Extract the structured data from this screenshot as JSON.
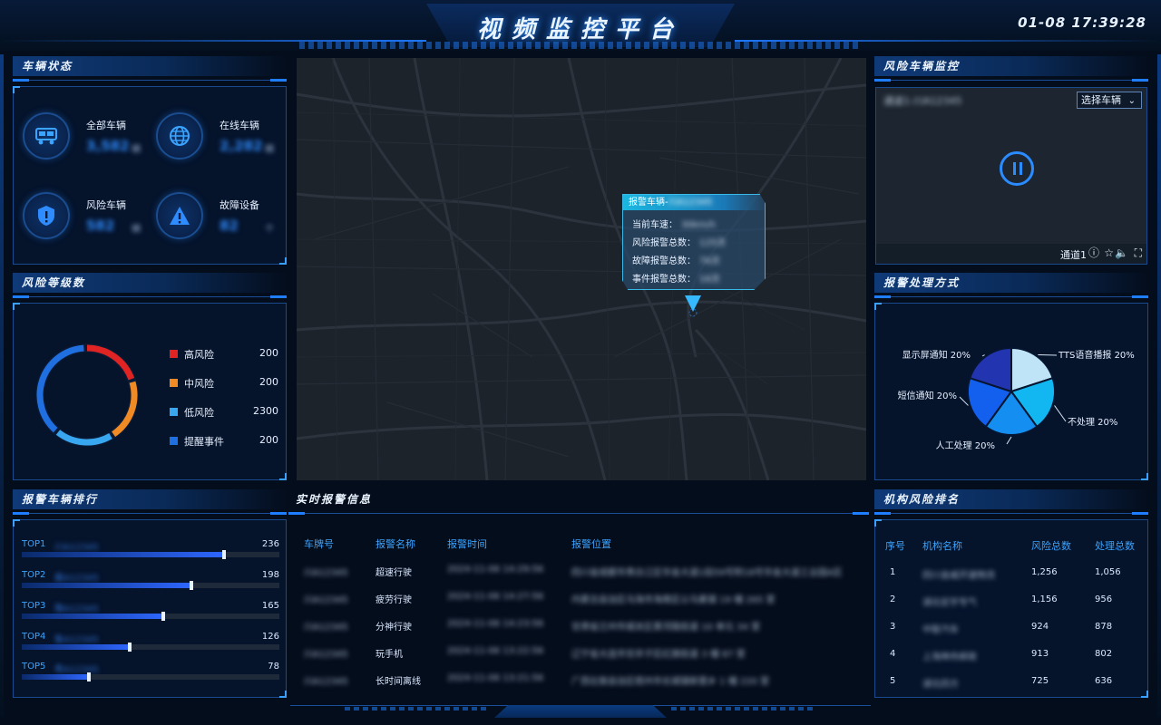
{
  "header": {
    "title": "视频监控平台",
    "clock": "01-08  17:39:28"
  },
  "vehicle_status": {
    "title": "车辆状态",
    "items": [
      {
        "label": "全部车辆",
        "value": "3,582",
        "unit": "辆",
        "icon": "truck-icon"
      },
      {
        "label": "在线车辆",
        "value": "2,282",
        "unit": "辆",
        "icon": "globe-icon"
      },
      {
        "label": "风险车辆",
        "value": "582",
        "unit": "辆",
        "icon": "shield-alert-icon"
      },
      {
        "label": "故障设备",
        "value": "82",
        "unit": "个",
        "icon": "warning-icon"
      }
    ]
  },
  "risk_levels": {
    "title": "风险等级数",
    "items": [
      {
        "name": "高风险",
        "value": "200",
        "color": "#e02424"
      },
      {
        "name": "中风险",
        "value": "200",
        "color": "#f08a24"
      },
      {
        "name": "低风险",
        "value": "2300",
        "color": "#39a6f0"
      },
      {
        "name": "提醒事件",
        "value": "200",
        "color": "#1f6fe0"
      }
    ]
  },
  "ranking": {
    "title": "报警车辆排行",
    "items": [
      {
        "rank": "TOP1",
        "plate": "川A12345",
        "value": 236
      },
      {
        "rank": "TOP2",
        "plate": "冀A12345",
        "value": 198
      },
      {
        "rank": "TOP3",
        "plate": "豫A12345",
        "value": 165
      },
      {
        "rank": "TOP4",
        "plate": "鲁A12345",
        "value": 126
      },
      {
        "rank": "TOP5",
        "plate": "粤A12345",
        "value": 78
      }
    ],
    "max": 300
  },
  "map_popup": {
    "head": "报警车辆-",
    "plate": "川A12345",
    "rows": [
      {
        "label": "当前车速：",
        "value": "30km/h"
      },
      {
        "label": "风险报警总数：",
        "value": "125次"
      },
      {
        "label": "故障报警总数：",
        "value": "76次"
      },
      {
        "label": "事件报警总数：",
        "value": "16次"
      }
    ]
  },
  "realtime": {
    "title": "实时报警信息",
    "columns": [
      "车牌号",
      "报警名称",
      "报警时间",
      "报警位置"
    ],
    "rows": [
      [
        "川A12345",
        "超速行驶",
        "2024-11-06  14:29:56",
        "四川省成都市青白江区华金大道1段59号附18号华金大道工业园A区"
      ],
      [
        "川A12345",
        "疲劳行驶",
        "2024-11-06  14:27:56",
        "内蒙古自治区乌海市海南区公乌素镇 19 幢 265 室"
      ],
      [
        "川A12345",
        "分神行驶",
        "2024-11-06  14:23:56",
        "甘肃省兰州市城关区黄河路街道 10 单元 34 室"
      ],
      [
        "川A12345",
        "玩手机",
        "2024-11-06  13:22:56",
        "辽宁省大连市甘井子区红旗街道 3 幢 87 室"
      ],
      [
        "川A12345",
        "长时间离线",
        "2024-11-06  13:21:56",
        "广西壮族自治区梧州市长城镇新堡乡 1 幢 220 室"
      ]
    ]
  },
  "video": {
    "title": "风险车辆监控",
    "camera": "通道1-川A12345",
    "select_label": "选择车辆",
    "channel": "通道1"
  },
  "handling": {
    "title": "报警处理方式",
    "chart_data": {
      "type": "pie",
      "series": [
        {
          "name": "TTS语音播报",
          "value": 20,
          "label": "20%",
          "color": "#bfe4f7"
        },
        {
          "name": "不处理",
          "value": 20,
          "label": "20%",
          "color": "#12b7f2"
        },
        {
          "name": "人工处理",
          "value": 20,
          "label": "20%",
          "color": "#148ef0"
        },
        {
          "name": "短信通知",
          "value": 20,
          "label": "20%",
          "color": "#1460ee"
        },
        {
          "name": "显示屏通知",
          "value": 20,
          "label": "20%",
          "color": "#2234b0"
        }
      ]
    }
  },
  "org_ranking": {
    "title": "机构风险排名",
    "columns": [
      "序号",
      "机构名称",
      "风险总数",
      "处理总数"
    ],
    "rows": [
      [
        "1",
        "四川金威开速物流",
        "1,256",
        "1,056"
      ],
      [
        "2",
        "湖北宏宇专气",
        "1,156",
        "956"
      ],
      [
        "3",
        "中联汽车",
        "924",
        "878"
      ],
      [
        "4",
        "上海神舟邮政",
        "913",
        "802"
      ],
      [
        "5",
        "湖北四方",
        "725",
        "636"
      ]
    ]
  }
}
